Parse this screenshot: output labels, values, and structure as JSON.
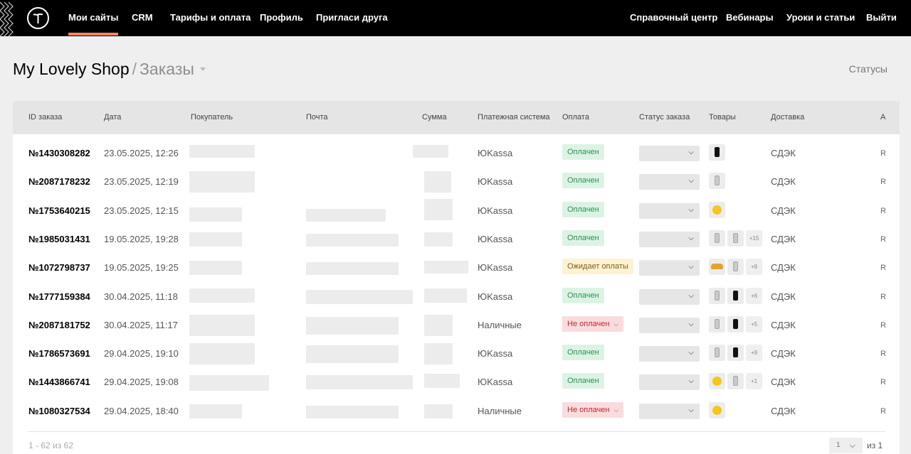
{
  "topnav": {
    "left": [
      "Мои сайты",
      "CRM",
      "Тарифы и оплата",
      "Профиль",
      "Пригласи друга"
    ],
    "right": [
      "Справочный центр",
      "Вебинары",
      "Уроки и статьи",
      "Выйти"
    ]
  },
  "breadcrumb": {
    "shop": "My Lovely Shop",
    "separator": "/",
    "page": "Заказы"
  },
  "statuses_link": "Статусы",
  "table": {
    "headers": [
      "ID заказа",
      "Дата",
      "Покупатель",
      "Почта",
      "Сумма",
      "Платежная система",
      "Оплата",
      "Статус заказа",
      "Товары",
      "Доставка",
      "А"
    ],
    "rows": [
      {
        "id": "№1430308282",
        "date": "23.05.2025, 12:26",
        "payment_system": "ЮKassa",
        "payment": "Оплачен",
        "payment_status": "paid",
        "items": [
          "phone-black"
        ],
        "more": "",
        "delivery": "СДЭК",
        "cut": "R"
      },
      {
        "id": "№2087178232",
        "date": "23.05.2025, 12:19",
        "payment_system": "ЮKassa",
        "payment": "Оплачен",
        "payment_status": "paid",
        "items": [
          "phone-grey"
        ],
        "more": "",
        "delivery": "СДЭК",
        "cut": "R"
      },
      {
        "id": "№1753640215",
        "date": "23.05.2025, 12:15",
        "payment_system": "ЮKassa",
        "payment": "Оплачен",
        "payment_status": "paid",
        "items": [
          "ball"
        ],
        "more": "",
        "delivery": "СДЭК",
        "cut": "R"
      },
      {
        "id": "№1985031431",
        "date": "19.05.2025, 19:28",
        "payment_system": "ЮKassa",
        "payment": "Оплачен",
        "payment_status": "paid",
        "items": [
          "phone-grey",
          "phone-grey"
        ],
        "more": "+15",
        "delivery": "СДЭК",
        "cut": "R"
      },
      {
        "id": "№1072798737",
        "date": "19.05.2025, 19:25",
        "payment_system": "ЮKassa",
        "payment": "Ожидает оплаты",
        "payment_status": "wait",
        "items": [
          "bread",
          "phone-grey"
        ],
        "more": "+8",
        "delivery": "СДЭК",
        "cut": "R"
      },
      {
        "id": "№1777159384",
        "date": "30.04.2025, 11:18",
        "payment_system": "ЮKassa",
        "payment": "Оплачен",
        "payment_status": "paid",
        "items": [
          "phone-grey",
          "phone-black"
        ],
        "more": "+6",
        "delivery": "СДЭК",
        "cut": "R"
      },
      {
        "id": "№2087181752",
        "date": "30.04.2025, 11:17",
        "payment_system": "Наличные",
        "payment": "Не оплачен",
        "payment_status": "unpaid",
        "items": [
          "phone-grey",
          "phone-black"
        ],
        "more": "+5",
        "delivery": "СДЭК",
        "cut": "R"
      },
      {
        "id": "№1786573691",
        "date": "29.04.2025, 19:10",
        "payment_system": "ЮKassa",
        "payment": "Оплачен",
        "payment_status": "paid",
        "items": [
          "phone-grey",
          "phone-black"
        ],
        "more": "+9",
        "delivery": "СДЭК",
        "cut": "R"
      },
      {
        "id": "№1443866741",
        "date": "29.04.2025, 19:08",
        "payment_system": "ЮKassa",
        "payment": "Оплачен",
        "payment_status": "paid",
        "items": [
          "ball",
          "phone-grey"
        ],
        "more": "+1",
        "delivery": "СДЭК",
        "cut": "R"
      },
      {
        "id": "№1080327534",
        "date": "29.04.2025, 18:40",
        "payment_system": "Наличные",
        "payment": "Не оплачен",
        "payment_status": "unpaid",
        "items": [
          "ball"
        ],
        "more": "",
        "delivery": "СДЭК",
        "cut": "R"
      }
    ]
  },
  "pagination": {
    "count": "1 - 62 из 62",
    "page": "1",
    "of": "из 1"
  },
  "colors": {
    "accent": "#ff8562",
    "paid_bg": "#dcf3e4",
    "wait_bg": "#fdf2d3",
    "unpaid_bg": "#fadcde"
  },
  "icons": {
    "logo": "tilda-logo",
    "dropdown": "chevron-down-icon"
  }
}
